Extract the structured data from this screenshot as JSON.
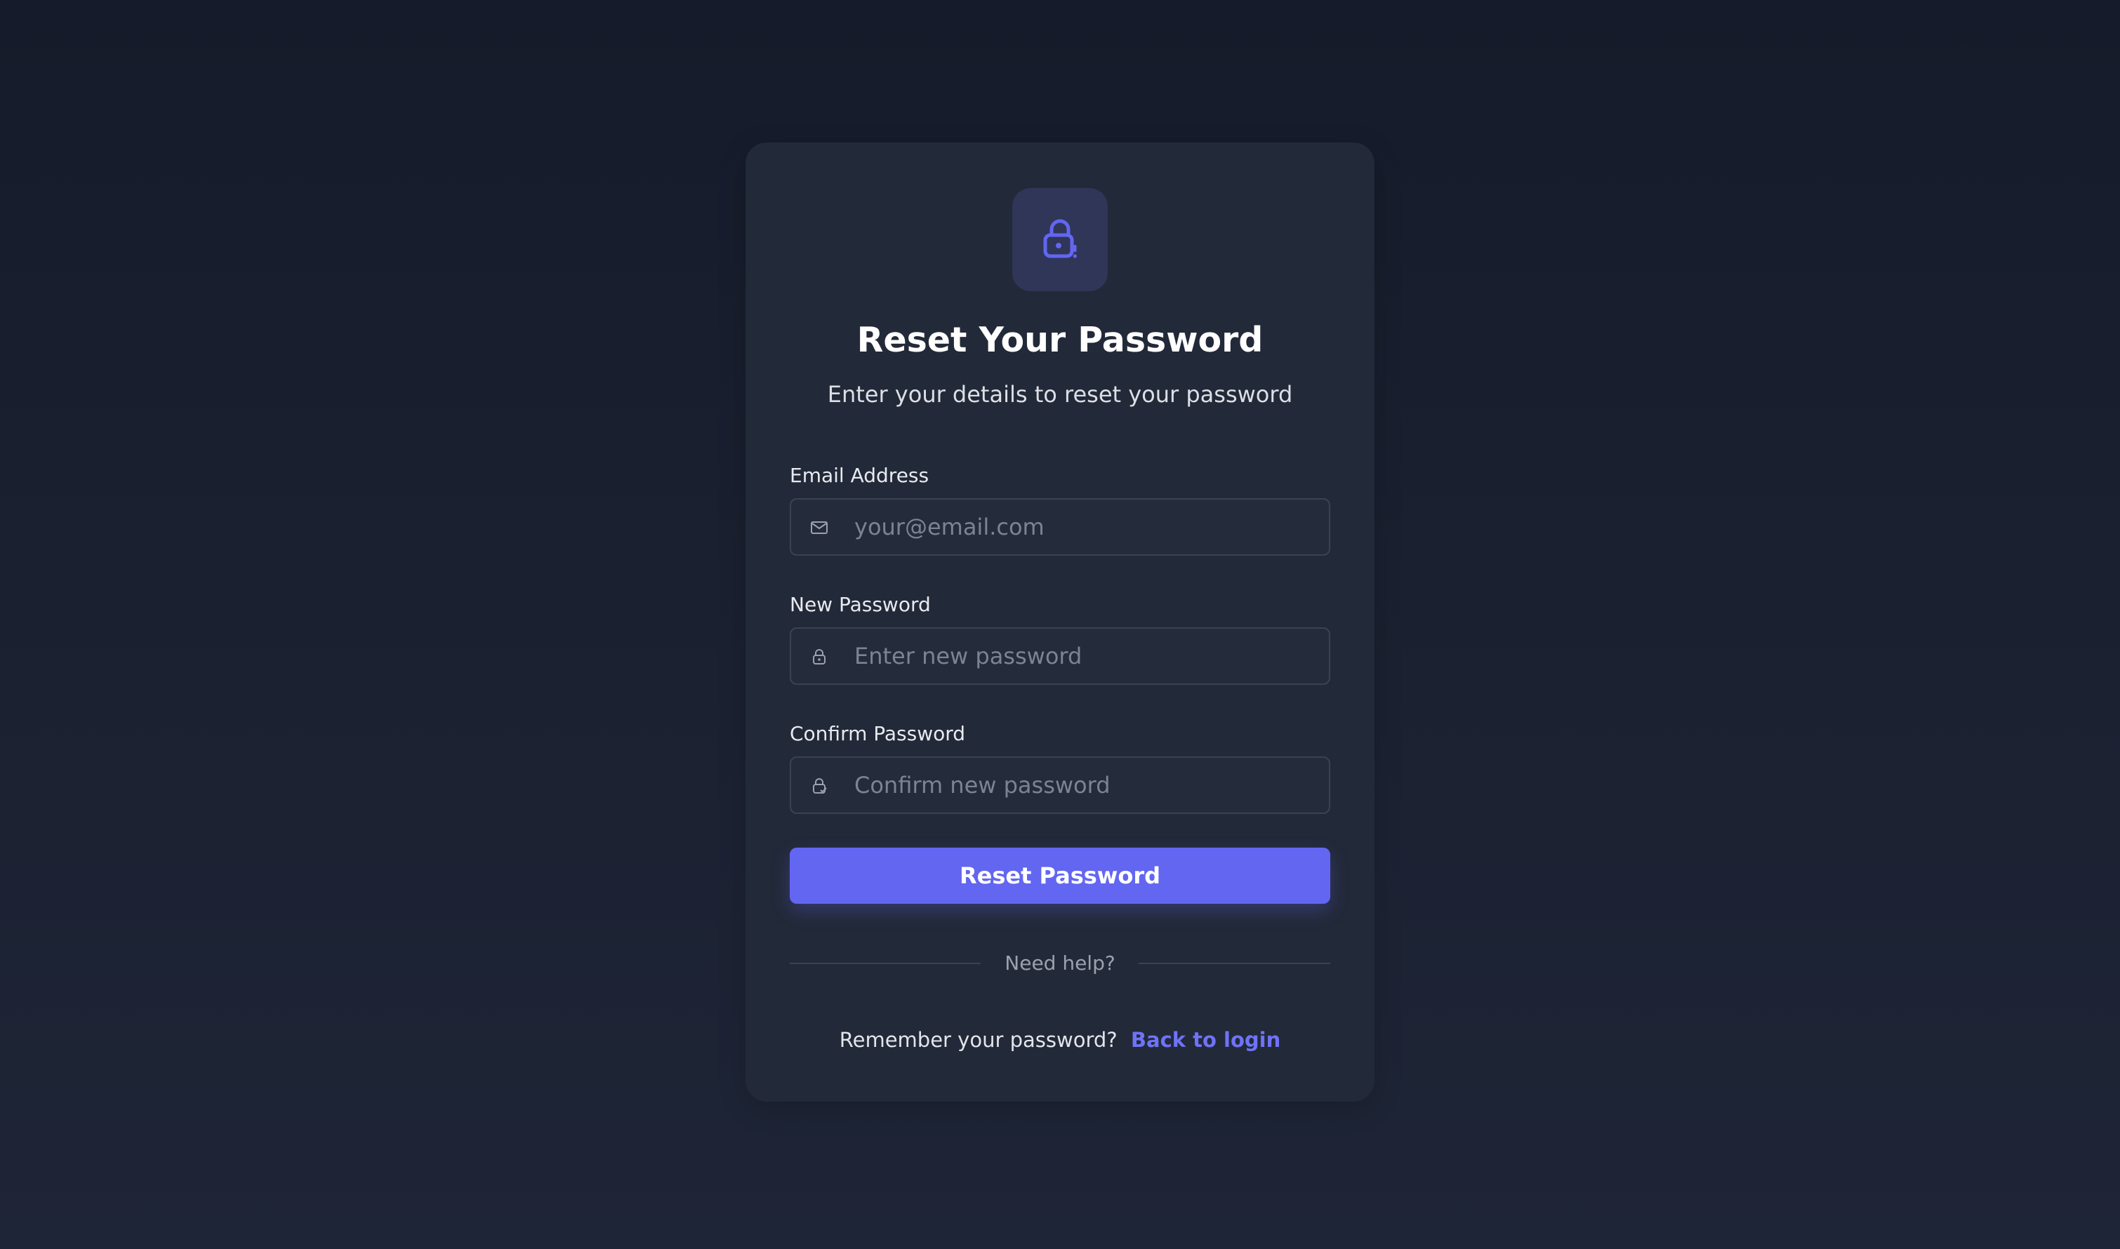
{
  "header": {
    "title": "Reset Your Password",
    "subtitle": "Enter your details to reset your password"
  },
  "form": {
    "email": {
      "label": "Email Address",
      "placeholder": "your@email.com",
      "value": "",
      "icon": "mail-icon"
    },
    "new_password": {
      "label": "New Password",
      "placeholder": "Enter new password",
      "value": "",
      "icon": "lock-icon"
    },
    "confirm_password": {
      "label": "Confirm Password",
      "placeholder": "Confirm new password",
      "value": "",
      "icon": "lock-check-icon"
    },
    "submit_label": "Reset Password"
  },
  "divider": {
    "text": "Need help?"
  },
  "footer": {
    "text": "Remember your password?",
    "link_label": "Back to login"
  },
  "colors": {
    "accent": "#6366f1",
    "card_background": "#222938",
    "page_background": "#171d2b",
    "badge_background": "#2f3658"
  },
  "badge_icon": "lock-alert-icon"
}
